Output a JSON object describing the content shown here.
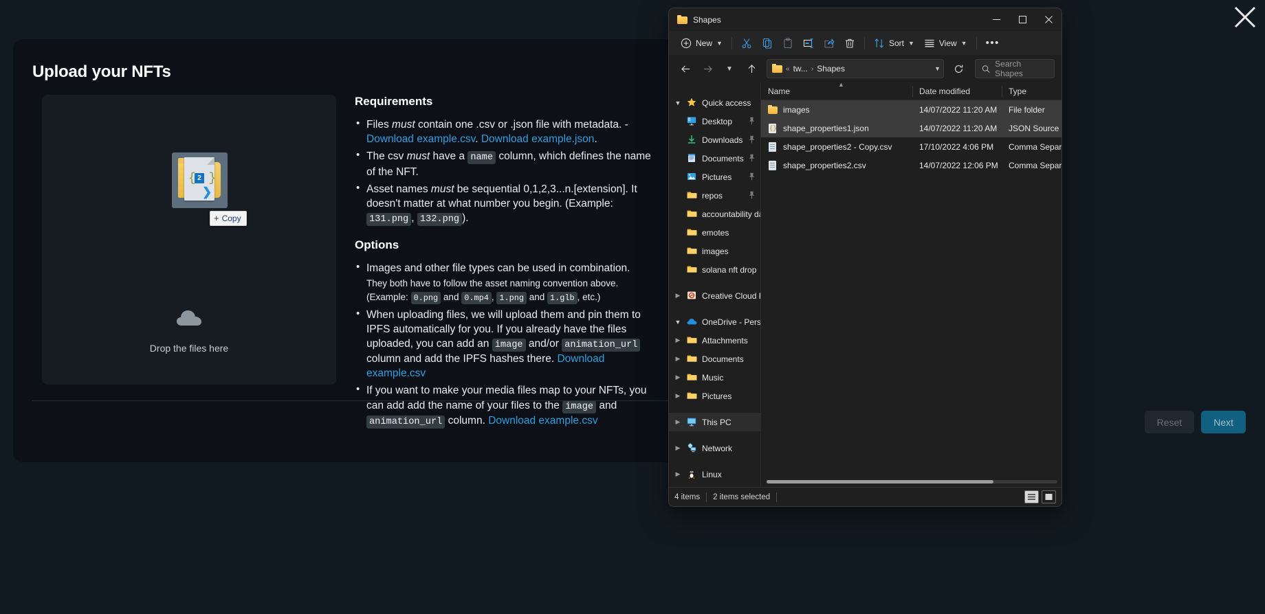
{
  "app": {
    "title": "Upload your NFTs",
    "dropzone": {
      "caption": "Drop the files here",
      "badge": "2"
    },
    "drag_chip": {
      "plus": "+",
      "label": "Copy"
    },
    "requirements": {
      "heading": "Requirements",
      "items": [
        {
          "parts": [
            {
              "t": "text",
              "v": "Files "
            },
            {
              "t": "em",
              "v": "must"
            },
            {
              "t": "text",
              "v": " contain one .csv or .json file with metadata. - "
            },
            {
              "t": "link",
              "v": "Download example.csv"
            },
            {
              "t": "text",
              "v": ". "
            },
            {
              "t": "link",
              "v": "Download example.json"
            },
            {
              "t": "text",
              "v": "."
            }
          ]
        },
        {
          "parts": [
            {
              "t": "text",
              "v": "The csv "
            },
            {
              "t": "em",
              "v": "must"
            },
            {
              "t": "text",
              "v": " have a "
            },
            {
              "t": "code",
              "v": "name"
            },
            {
              "t": "text",
              "v": " column, which defines the name of the NFT."
            }
          ]
        },
        {
          "parts": [
            {
              "t": "text",
              "v": "Asset names "
            },
            {
              "t": "em",
              "v": "must"
            },
            {
              "t": "text",
              "v": " be sequential 0,1,2,3...n.[extension]. It doesn't matter at what number you begin. (Example: "
            },
            {
              "t": "code",
              "v": "131.png"
            },
            {
              "t": "text",
              "v": ", "
            },
            {
              "t": "code",
              "v": "132.png"
            },
            {
              "t": "text",
              "v": ")."
            }
          ]
        }
      ]
    },
    "options": {
      "heading": "Options",
      "items": [
        {
          "parts": [
            {
              "t": "text",
              "v": "Images and other file types can be used in combination."
            }
          ],
          "sub_parts": [
            {
              "t": "text",
              "v": "They both have to follow the asset naming convention above. (Example: "
            },
            {
              "t": "code",
              "v": "0.png"
            },
            {
              "t": "text",
              "v": " and "
            },
            {
              "t": "code",
              "v": "0.mp4"
            },
            {
              "t": "text",
              "v": ", "
            },
            {
              "t": "code",
              "v": "1.png"
            },
            {
              "t": "text",
              "v": " and "
            },
            {
              "t": "code",
              "v": "1.glb"
            },
            {
              "t": "text",
              "v": ", etc.)"
            }
          ]
        },
        {
          "parts": [
            {
              "t": "text",
              "v": "When uploading files, we will upload them and pin them to IPFS automatically for you. If you already have the files uploaded, you can add an "
            },
            {
              "t": "code",
              "v": "image"
            },
            {
              "t": "text",
              "v": " and/or "
            },
            {
              "t": "code",
              "v": "animation_url"
            },
            {
              "t": "text",
              "v": " column and add the IPFS hashes there. "
            },
            {
              "t": "link",
              "v": "Download example.csv"
            }
          ]
        },
        {
          "parts": [
            {
              "t": "text",
              "v": "If you want to make your media files map to your NFTs, you can add add the name of your files to the "
            },
            {
              "t": "code",
              "v": "image"
            },
            {
              "t": "text",
              "v": " and "
            },
            {
              "t": "code",
              "v": "animation_url"
            },
            {
              "t": "text",
              "v": " column. "
            },
            {
              "t": "link",
              "v": "Download example.csv"
            }
          ]
        }
      ]
    },
    "buttons": {
      "reset": "Reset",
      "next": "Next"
    },
    "accent": "#12607f",
    "link_color": "#2f9fe0"
  },
  "explorer": {
    "window_title": "Shapes",
    "window_controls": {
      "minimize": "—",
      "maximize": "☐",
      "close": "✕"
    },
    "toolbar": {
      "new_label": "New",
      "sort_label": "Sort",
      "view_label": "View",
      "more_label": "•••",
      "icons": [
        "cut-icon",
        "copy-icon",
        "paste-icon",
        "rename-icon",
        "share-icon",
        "delete-icon"
      ]
    },
    "address": {
      "breadcrumb_prefix": "«",
      "breadcrumb_root": "tw...",
      "breadcrumb_sep": "›",
      "breadcrumb_current": "Shapes",
      "search_placeholder": "Search Shapes"
    },
    "sidebar": [
      {
        "label": "Quick access",
        "icon": "star-icon",
        "arrow": "open",
        "indent": 0,
        "pin": false
      },
      {
        "label": "Desktop",
        "icon": "desktop-icon",
        "arrow": "none",
        "indent": 1,
        "pin": true
      },
      {
        "label": "Downloads",
        "icon": "download-icon",
        "arrow": "none",
        "indent": 1,
        "pin": true
      },
      {
        "label": "Documents",
        "icon": "documents-icon",
        "arrow": "none",
        "indent": 1,
        "pin": true
      },
      {
        "label": "Pictures",
        "icon": "pictures-icon",
        "arrow": "none",
        "indent": 1,
        "pin": true
      },
      {
        "label": "repos",
        "icon": "folder-icon",
        "arrow": "none",
        "indent": 1,
        "pin": true
      },
      {
        "label": "accountability dao",
        "icon": "folder-icon",
        "arrow": "none",
        "indent": 1,
        "pin": false
      },
      {
        "label": "emotes",
        "icon": "folder-icon",
        "arrow": "none",
        "indent": 1,
        "pin": false
      },
      {
        "label": "images",
        "icon": "folder-icon",
        "arrow": "none",
        "indent": 1,
        "pin": false
      },
      {
        "label": "solana nft drop",
        "icon": "folder-icon",
        "arrow": "none",
        "indent": 1,
        "pin": false
      },
      {
        "label": "Creative Cloud Files",
        "icon": "creative-cloud-icon",
        "arrow": "closed",
        "indent": 0,
        "pin": false
      },
      {
        "label": "OneDrive - Personal",
        "icon": "onedrive-icon",
        "arrow": "open",
        "indent": 0,
        "pin": false
      },
      {
        "label": "Attachments",
        "icon": "folder-icon",
        "arrow": "closed",
        "indent": 1,
        "pin": false
      },
      {
        "label": "Documents",
        "icon": "folder-icon",
        "arrow": "closed",
        "indent": 1,
        "pin": false
      },
      {
        "label": "Music",
        "icon": "folder-icon",
        "arrow": "closed",
        "indent": 1,
        "pin": false
      },
      {
        "label": "Pictures",
        "icon": "folder-icon",
        "arrow": "closed",
        "indent": 1,
        "pin": false
      },
      {
        "label": "This PC",
        "icon": "thispc-icon",
        "arrow": "closed",
        "indent": 0,
        "pin": false,
        "selected": true
      },
      {
        "label": "Network",
        "icon": "network-icon",
        "arrow": "closed",
        "indent": 0,
        "pin": false
      },
      {
        "label": "Linux",
        "icon": "linux-icon",
        "arrow": "closed",
        "indent": 0,
        "pin": false
      }
    ],
    "columns": [
      "Name",
      "Date modified",
      "Type"
    ],
    "rows": [
      {
        "name": "images",
        "date": "14/07/2022 11:20 AM",
        "type": "File folder",
        "icon": "folder-icon",
        "selected": true
      },
      {
        "name": "shape_properties1.json",
        "date": "14/07/2022 11:20 AM",
        "type": "JSON Source File",
        "icon": "json-icon",
        "selected": true
      },
      {
        "name": "shape_properties2 - Copy.csv",
        "date": "17/10/2022 4:06 PM",
        "type": "Comma Separated",
        "icon": "doc-icon",
        "selected": false
      },
      {
        "name": "shape_properties2.csv",
        "date": "14/07/2022 12:06 PM",
        "type": "Comma Separated",
        "icon": "doc-icon",
        "selected": false
      }
    ],
    "status": {
      "items_count": "4 items",
      "selected_count": "2 items selected",
      "trailing": ""
    }
  }
}
